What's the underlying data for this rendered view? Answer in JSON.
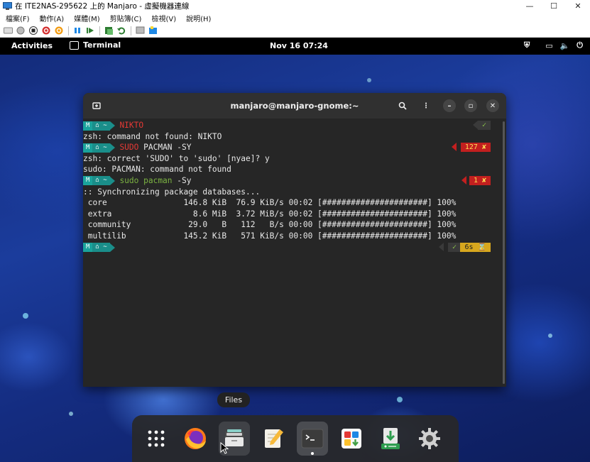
{
  "host": {
    "title": "在 ITE2NAS-295622 上的 Manjaro - 虛擬機器連線",
    "menus": [
      "檔案(F)",
      "動作(A)",
      "媒體(M)",
      "剪貼簿(C)",
      "檢視(V)",
      "說明(H)"
    ]
  },
  "topbar": {
    "activities": "Activities",
    "app": "Terminal",
    "clock": "Nov 16  07:24"
  },
  "terminal": {
    "title": "manjaro@manjaro-gnome:~",
    "prompt_os": "M",
    "prompt_dir": "~",
    "lines": [
      {
        "kind": "prompt",
        "cmd": "NIKTO",
        "cmd_color": "red",
        "status": "✓",
        "status_kind": "ok"
      },
      {
        "kind": "out",
        "text": "zsh: command not found: NIKTO"
      },
      {
        "kind": "prompt",
        "cmd_a": "SUDO",
        "cmd_b": " PACMAN -SY",
        "status": "127 ✘",
        "status_kind": "err"
      },
      {
        "kind": "out",
        "text": "zsh: correct 'SUDO' to 'sudo' [nyae]? y"
      },
      {
        "kind": "out",
        "text": "sudo: PACMAN: command not found"
      },
      {
        "kind": "prompt",
        "cmd_a": "sudo pacman",
        "cmd_b": " -Sy",
        "status": "1 ✘",
        "status_kind": "err"
      },
      {
        "kind": "out",
        "text": ":: Synchronizing package databases..."
      },
      {
        "kind": "out",
        "text": " core                146.8 KiB  76.9 KiB/s 00:02 [######################] 100%"
      },
      {
        "kind": "out",
        "text": " extra                 8.6 MiB  3.72 MiB/s 00:02 [######################] 100%"
      },
      {
        "kind": "out",
        "text": " community            29.0   B   112   B/s 00:00 [######################] 100%"
      },
      {
        "kind": "out",
        "text": " multilib            145.2 KiB   571 KiB/s 00:00 [######################] 100%"
      },
      {
        "kind": "prompt_last",
        "status_ok": "✓",
        "status_time": "6s ⌛"
      }
    ]
  },
  "tooltip": "Files",
  "dock": [
    {
      "name": "app-grid",
      "icon": "grid-icon"
    },
    {
      "name": "firefox",
      "icon": "firefox-icon"
    },
    {
      "name": "files",
      "icon": "files-icon"
    },
    {
      "name": "text-editor",
      "icon": "text-editor-icon"
    },
    {
      "name": "terminal",
      "icon": "terminal-icon"
    },
    {
      "name": "software",
      "icon": "software-icon"
    },
    {
      "name": "package-manager",
      "icon": "package-icon"
    },
    {
      "name": "settings",
      "icon": "settings-icon"
    }
  ]
}
